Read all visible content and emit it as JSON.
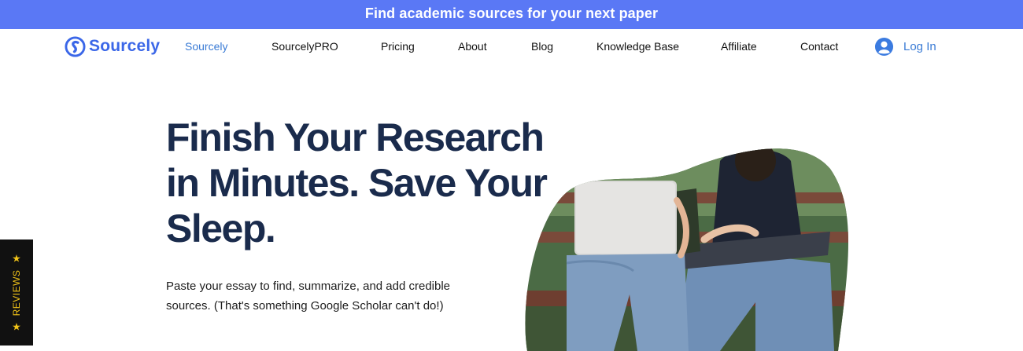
{
  "banner": {
    "text": "Find academic sources for your next paper"
  },
  "header": {
    "logo_text": "Sourcely",
    "nav": [
      {
        "label": "Sourcely"
      },
      {
        "label": "SourcelyPRO"
      },
      {
        "label": "Pricing"
      },
      {
        "label": "About"
      },
      {
        "label": "Blog"
      },
      {
        "label": "Knowledge Base"
      },
      {
        "label": "Affiliate"
      },
      {
        "label": "Contact"
      }
    ],
    "login_label": "Log In"
  },
  "hero": {
    "title": "Finish Your Research in Minutes. Save Your Sleep.",
    "subtitle": "Paste your essay to find, summarize, and add credible sources. (That's something Google Scholar can't do!)"
  },
  "reviews_tab": {
    "label": "REVIEWS"
  },
  "colors": {
    "banner_bg": "#5a78f5",
    "brand": "#3b67e8",
    "nav_active": "#3a7bd5",
    "heading": "#1a2b4c",
    "reviews_bg": "#111111",
    "reviews_accent": "#f2c418"
  },
  "icons": {
    "logo": "sourcely-logo-icon",
    "login": "user-avatar-icon",
    "star": "star-icon"
  }
}
